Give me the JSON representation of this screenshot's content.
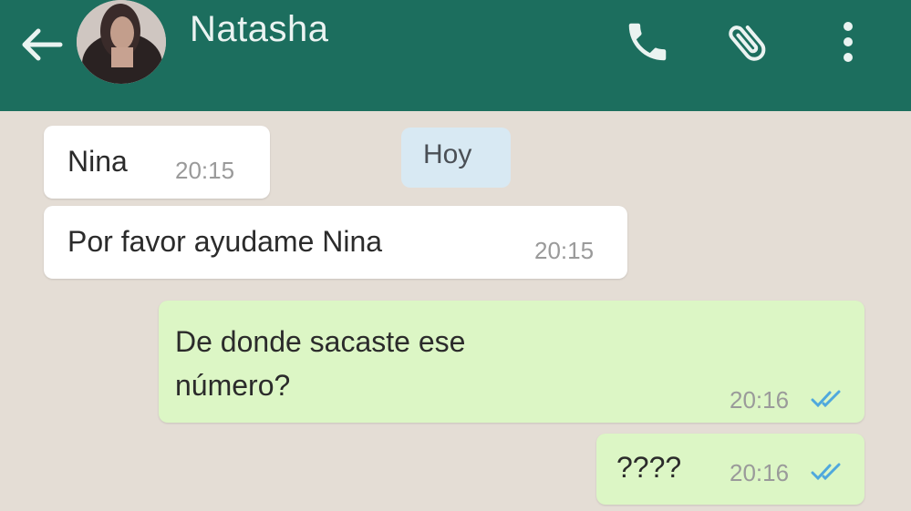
{
  "header": {
    "contact_name": "Natasha",
    "bg_color": "#1c6e5e",
    "icons": [
      "arrow-left-icon",
      "phone-icon",
      "paperclip-icon",
      "more-vert-icon"
    ]
  },
  "chat": {
    "bg_color": "#e4ddd5",
    "date_label": "Hoy",
    "messages": [
      {
        "direction": "incoming",
        "text": "Nina",
        "time": "20:15"
      },
      {
        "direction": "incoming",
        "text": "Por favor ayudame Nina",
        "time": "20:15"
      },
      {
        "direction": "outgoing",
        "text_line1": "De donde sacaste ese",
        "text_line2": "número?",
        "time": "20:16",
        "status": "read"
      },
      {
        "direction": "outgoing",
        "text": "????",
        "time": "20:16",
        "status": "read"
      }
    ],
    "incoming_color": "#ffffff",
    "outgoing_color": "#dcf6c5",
    "read_tick_color": "#4fa8dd"
  }
}
